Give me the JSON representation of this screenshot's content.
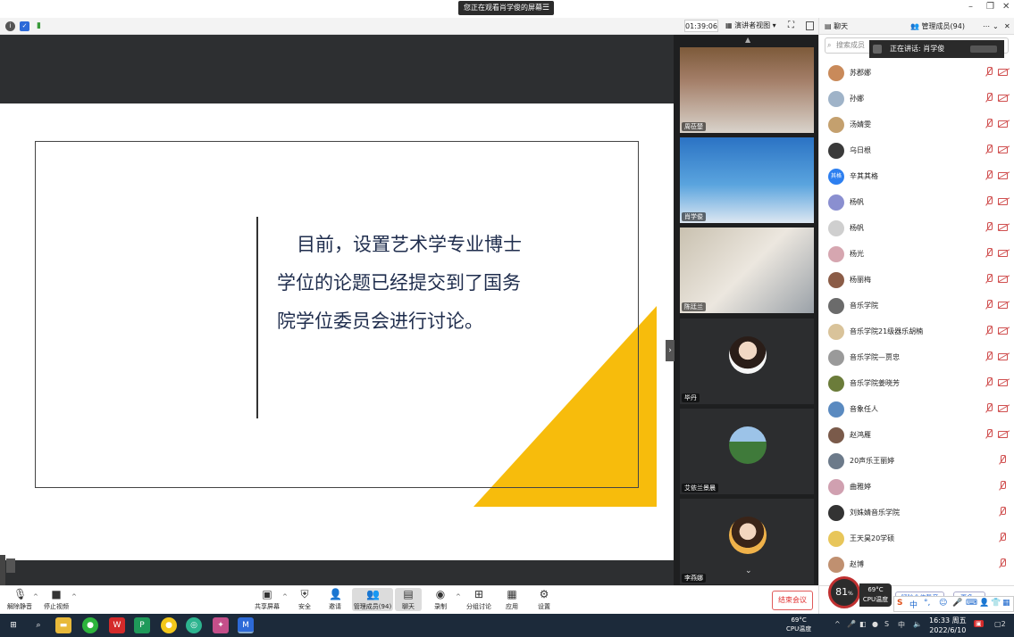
{
  "share_banner": {
    "text": "您正在观看肖学俊的屏幕",
    "menu_icon": "menu-icon"
  },
  "toolbar": {
    "timer": "01:39:06",
    "view_mode": "演讲者视图",
    "view_caret": "▾"
  },
  "slide": {
    "lines": [
      "目前，设置艺术学专业博士",
      "学位的论题已经提交到了国务",
      "院学位委员会进行讨论。"
    ],
    "accent_color": "#f7bc0c",
    "text_color": "#1f2d4d"
  },
  "video_tiles": [
    {
      "name": "周莅楚",
      "avatar": ""
    },
    {
      "name": "肖学俊",
      "avatar": ""
    },
    {
      "name": "陈廷兰",
      "avatar": ""
    },
    {
      "name": "毕丹",
      "avatar": "portrait"
    },
    {
      "name": "艾依兰景晨",
      "avatar": "landscape"
    },
    {
      "name": "李燕娜",
      "avatar": "portrait"
    }
  ],
  "controls": {
    "unmute": "解除静音",
    "stop_video": "停止视频",
    "share_screen": "共享屏幕",
    "security": "安全",
    "invite": "邀请",
    "manage_members": "管理成员(94)",
    "chat": "聊天",
    "record": "录制",
    "breakout": "分组讨论",
    "apps": "应用",
    "settings": "设置",
    "end_meeting": "结束会议"
  },
  "right_panel": {
    "tab_chat": "聊天",
    "tab_members": "管理成员(94)",
    "search_placeholder": "搜索成员",
    "speaking_prefix": "正在讲话: 肖学俊",
    "members": [
      {
        "name": "苏郡娜",
        "color": "#c98a5a"
      },
      {
        "name": "孙娜",
        "color": "#9fb3c8"
      },
      {
        "name": "汤婧雯",
        "color": "#c4a06e"
      },
      {
        "name": "乌日根",
        "color": "#3a3a3a"
      },
      {
        "name": "辛其其格",
        "color": "#2d7ff0",
        "initials": "其格"
      },
      {
        "name": "杨帆",
        "color": "#8a8fd0"
      },
      {
        "name": "杨帆",
        "color": "#cfcfcf"
      },
      {
        "name": "杨光",
        "color": "#d6a6b0"
      },
      {
        "name": "杨丽梅",
        "color": "#8b5c47"
      },
      {
        "name": "音乐学院",
        "color": "#6b6b6b"
      },
      {
        "name": "音乐学院21级器乐胡楠",
        "color": "#d9c39a"
      },
      {
        "name": "音乐学院—贾忠",
        "color": "#9a9a9a"
      },
      {
        "name": "音乐学院姜晓芳",
        "color": "#6b7c3a"
      },
      {
        "name": "音象任人",
        "color": "#5a8ac0"
      },
      {
        "name": "赵鸿雁",
        "color": "#7a5a4a"
      },
      {
        "name": "20声乐王丽婷",
        "color": "#6c7a8a"
      },
      {
        "name": "曲雅婷",
        "color": "#d0a0b0"
      },
      {
        "name": "刘姝婧音乐学院",
        "color": "#333333"
      },
      {
        "name": "王天昊20学硕",
        "color": "#e8c65a"
      },
      {
        "name": "赵博",
        "color": "#c09070"
      }
    ],
    "mute_all": "解除全体静音",
    "more": "更多 ▾"
  },
  "cpu": {
    "percent": "81",
    "percent_unit": "%",
    "temp": "69°C",
    "label": "CPU温度"
  },
  "ime": {
    "lang": "中"
  },
  "taskbar": {
    "temp": "69°C",
    "temp_label": "CPU温度",
    "time": "16:33 周五",
    "date": "2022/6/10",
    "ime": "中",
    "notify_count": "2"
  }
}
